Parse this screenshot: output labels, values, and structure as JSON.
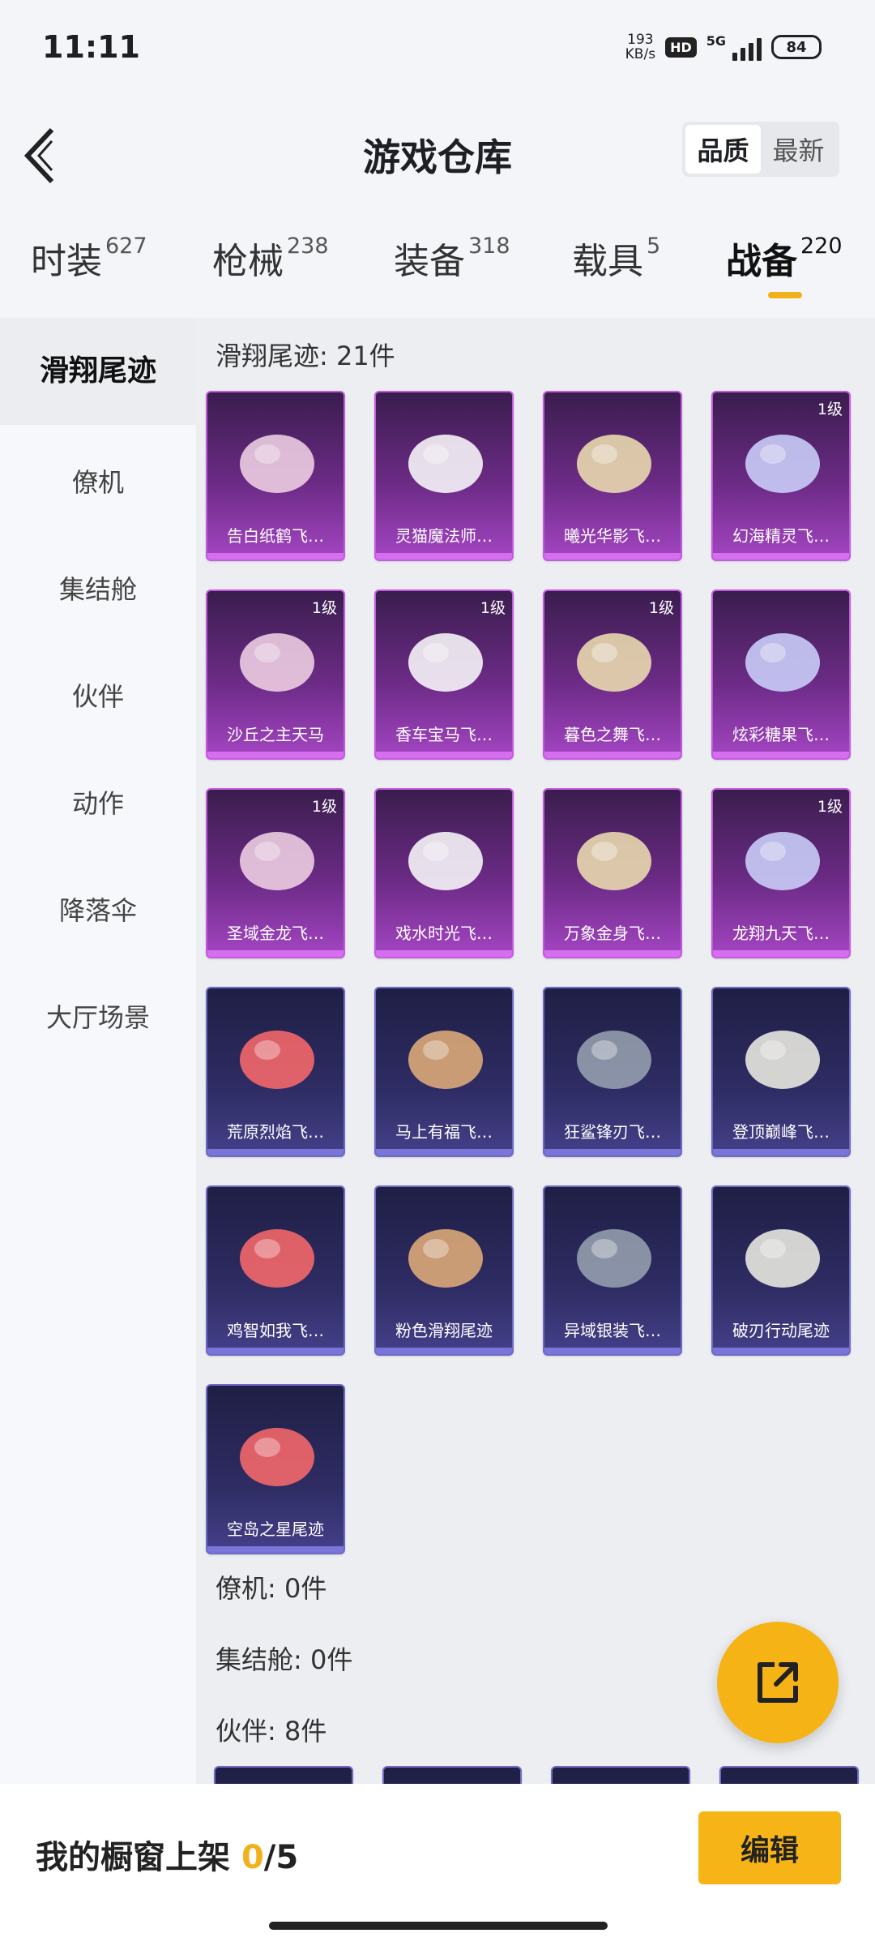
{
  "status": {
    "time": "11:11",
    "net_speed_value": "193",
    "net_speed_unit": "KB/s",
    "hd": "HD",
    "network": "5G",
    "battery": "84"
  },
  "header": {
    "title": "游戏仓库",
    "sort_options": [
      "品质",
      "最新"
    ],
    "sort_active": "品质"
  },
  "tabs": [
    {
      "label": "时装",
      "count": "627"
    },
    {
      "label": "枪械",
      "count": "238"
    },
    {
      "label": "装备",
      "count": "318"
    },
    {
      "label": "载具",
      "count": "5"
    },
    {
      "label": "战备",
      "count": "220"
    }
  ],
  "sidebar": {
    "items": [
      "滑翔尾迹",
      "僚机",
      "集结舱",
      "伙伴",
      "动作",
      "降落伞",
      "大厅场景"
    ],
    "active": "滑翔尾迹"
  },
  "content": {
    "section_glide": "滑翔尾迹: 21件",
    "cards": [
      {
        "name": "告白纸鹤飞…",
        "rarity": "purple",
        "level": "",
        "icon": "paper-crane-icon"
      },
      {
        "name": "灵猫魔法师…",
        "rarity": "purple",
        "level": "",
        "icon": "cat-icon"
      },
      {
        "name": "曦光华影飞…",
        "rarity": "purple",
        "level": "",
        "icon": "flower-icon"
      },
      {
        "name": "幻海精灵飞…",
        "rarity": "purple",
        "level": "1级",
        "icon": "jellyfish-icon"
      },
      {
        "name": "沙丘之主天马",
        "rarity": "purple",
        "level": "1级",
        "icon": "pegasus-icon"
      },
      {
        "name": "香车宝马飞…",
        "rarity": "purple",
        "level": "1级",
        "icon": "carriage-icon"
      },
      {
        "name": "暮色之舞飞…",
        "rarity": "purple",
        "level": "1级",
        "icon": "comet-icon"
      },
      {
        "name": "炫彩糖果飞…",
        "rarity": "purple",
        "level": "",
        "icon": "candy-icon"
      },
      {
        "name": "圣域金龙飞…",
        "rarity": "purple",
        "level": "1级",
        "icon": "dragon-icon"
      },
      {
        "name": "戏水时光飞…",
        "rarity": "purple",
        "level": "",
        "icon": "giraffe-icon"
      },
      {
        "name": "万象金身飞…",
        "rarity": "purple",
        "level": "",
        "icon": "fireball-icon"
      },
      {
        "name": "龙翔九天飞…",
        "rarity": "purple",
        "level": "1级",
        "icon": "black-dragon-icon"
      },
      {
        "name": "荒原烈焰飞…",
        "rarity": "blue",
        "level": "",
        "icon": "flame-glider-icon"
      },
      {
        "name": "马上有福飞…",
        "rarity": "blue",
        "level": "",
        "icon": "horse-toy-icon"
      },
      {
        "name": "狂鲨锋刃飞…",
        "rarity": "blue",
        "level": "",
        "icon": "shark-icon"
      },
      {
        "name": "登顶巅峰飞…",
        "rarity": "blue",
        "level": "",
        "icon": "jet-icon"
      },
      {
        "name": "鸡智如我飞…",
        "rarity": "blue",
        "level": "",
        "icon": "chicken-icon"
      },
      {
        "name": "粉色滑翔尾迹",
        "rarity": "blue",
        "level": "",
        "icon": "pink-trail-icon"
      },
      {
        "name": "异域银装飞…",
        "rarity": "blue",
        "level": "",
        "icon": "mask-glider-icon"
      },
      {
        "name": "破刃行动尾迹",
        "rarity": "blue",
        "level": "",
        "icon": "rainbow-trail-icon"
      },
      {
        "name": "空岛之星尾迹",
        "rarity": "blue",
        "level": "",
        "icon": "star-trail-icon"
      }
    ],
    "section_wingman": "僚机: 0件",
    "section_pod": "集结舱: 0件",
    "section_partner": "伙伴: 8件"
  },
  "bottom": {
    "showcase_label": "我的橱窗上架 ",
    "showcase_current": "0",
    "showcase_total": "/5",
    "edit_label": "编辑"
  },
  "colors": {
    "accent": "#f2b11c",
    "purple_card": "#a445c3",
    "blue_card": "#45408a"
  }
}
